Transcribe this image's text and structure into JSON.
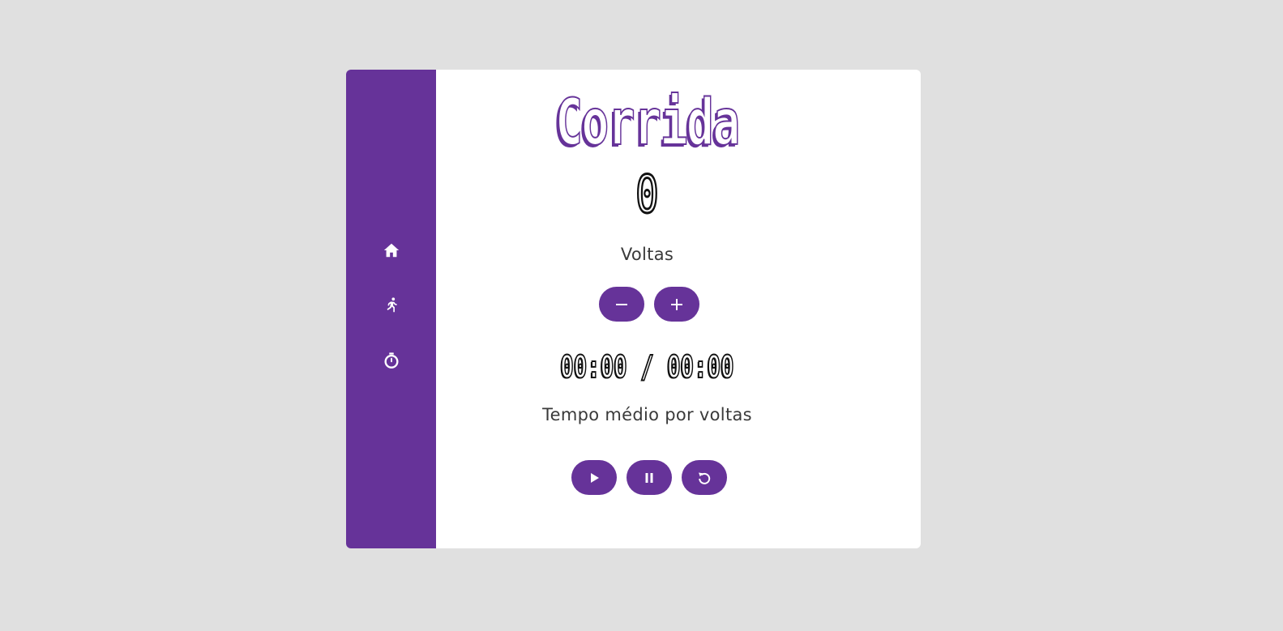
{
  "colors": {
    "accent": "#663399",
    "background": "#e0e0e0",
    "card": "#ffffff",
    "text": "#3a3a3a"
  },
  "sidebar": {
    "items": [
      {
        "icon": "home-icon"
      },
      {
        "icon": "running-icon"
      },
      {
        "icon": "stopwatch-icon"
      }
    ]
  },
  "main": {
    "title": "Corrida",
    "lap_count": "0",
    "laps_label": "Voltas",
    "time_display": "00:00 / 00:00",
    "time_label": "Tempo médio por voltas",
    "lap_controls": [
      {
        "icon": "minus-icon"
      },
      {
        "icon": "plus-icon"
      }
    ],
    "timer_controls": [
      {
        "icon": "play-icon"
      },
      {
        "icon": "pause-icon"
      },
      {
        "icon": "restart-icon"
      }
    ]
  }
}
